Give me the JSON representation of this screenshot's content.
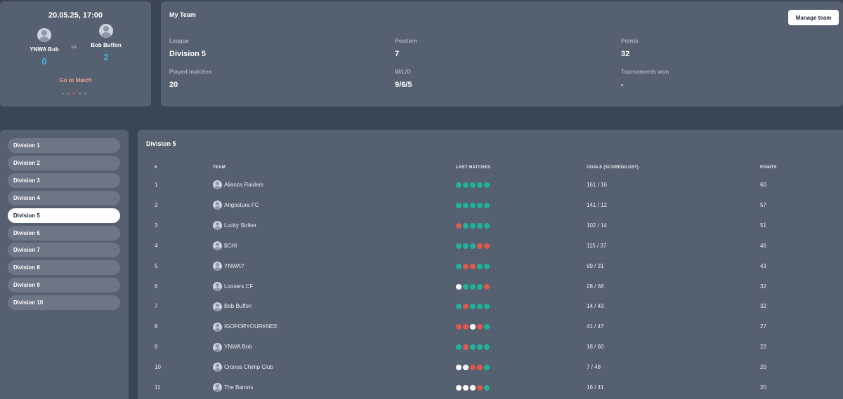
{
  "match": {
    "datetime": "20.05.25, 17:00",
    "team_a": {
      "name": "YNWA Bob",
      "score": "0"
    },
    "vs": "vs",
    "team_b": {
      "name": "Bob Buffon",
      "score": "2"
    },
    "goto_label": "Go to Match"
  },
  "my_team": {
    "title": "My Team",
    "manage_label": "Manage team",
    "stats": [
      {
        "label": "League",
        "value": "Division 5"
      },
      {
        "label": "Position",
        "value": "7"
      },
      {
        "label": "Points",
        "value": "32"
      },
      {
        "label": "Played matches",
        "value": "20"
      },
      {
        "label": "W/L/D",
        "value": "9/6/5"
      },
      {
        "label": "Tournaments won",
        "value": "-"
      }
    ]
  },
  "divisions": {
    "active_index": 4,
    "items": [
      "Division 1",
      "Division 2",
      "Division 3",
      "Division 4",
      "Division 5",
      "Division 6",
      "Division 7",
      "Division 8",
      "Division 9",
      "Division 10"
    ]
  },
  "standings": {
    "title": "Division 5",
    "headers": {
      "rank": "#",
      "team": "TEAM",
      "last": "LAST MATCHES",
      "goals": "GOALS (SCORED/LOST)",
      "points": "POINTS"
    },
    "colors": {
      "win": "#20b29a",
      "loss": "#e0584a",
      "draw": "#ffffff"
    },
    "rows": [
      {
        "rank": "1",
        "team": "Alianza Raiders",
        "last": [
          "w",
          "w",
          "w",
          "w",
          "w"
        ],
        "goals": "161 / 16",
        "points": "60"
      },
      {
        "rank": "2",
        "team": "Angostura FC",
        "last": [
          "w",
          "w",
          "w",
          "w",
          "w"
        ],
        "goals": "141 / 12",
        "points": "57"
      },
      {
        "rank": "3",
        "team": "Lucky Striker",
        "last": [
          "l",
          "w",
          "w",
          "w",
          "w"
        ],
        "goals": "102 / 14",
        "points": "51"
      },
      {
        "rank": "4",
        "team": "$CHI",
        "last": [
          "w",
          "w",
          "w",
          "l",
          "l"
        ],
        "goals": "115 / 37",
        "points": "46"
      },
      {
        "rank": "5",
        "team": "YNWA?",
        "last": [
          "w",
          "l",
          "l",
          "w",
          "w"
        ],
        "goals": "99 / 31",
        "points": "43"
      },
      {
        "rank": "6",
        "team": "Loosers CF",
        "last": [
          "d",
          "w",
          "w",
          "w",
          "l"
        ],
        "goals": "28 / 68",
        "points": "32"
      },
      {
        "rank": "7",
        "team": "Bob Buffon",
        "last": [
          "w",
          "l",
          "w",
          "w",
          "w"
        ],
        "goals": "14 / 43",
        "points": "32"
      },
      {
        "rank": "8",
        "team": "IGOFORYOURKNEE",
        "last": [
          "l",
          "l",
          "d",
          "l",
          "w"
        ],
        "goals": "41 / 47",
        "points": "27"
      },
      {
        "rank": "9",
        "team": "YNWA Bob",
        "last": [
          "w",
          "l",
          "w",
          "w",
          "w"
        ],
        "goals": "18 / 60",
        "points": "22"
      },
      {
        "rank": "10",
        "team": "Cronos Chimp Club",
        "last": [
          "d",
          "d",
          "l",
          "l",
          "w"
        ],
        "goals": "7 / 48",
        "points": "20"
      },
      {
        "rank": "11",
        "team": "The Barons",
        "last": [
          "d",
          "d",
          "d",
          "l",
          "w"
        ],
        "goals": "16 / 41",
        "points": "20"
      }
    ]
  }
}
